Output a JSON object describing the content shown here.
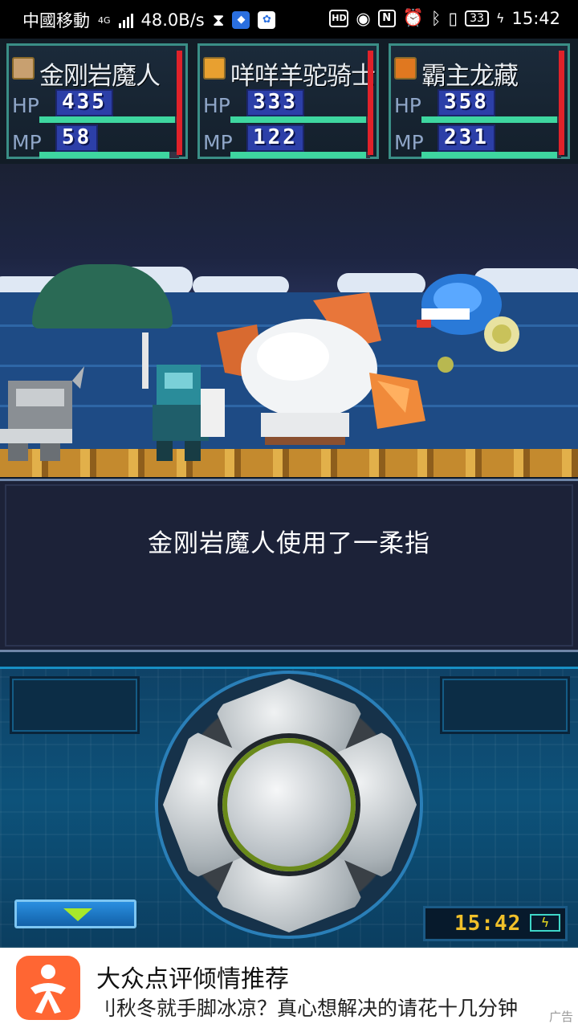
{
  "status_bar": {
    "carrier": "中國移動",
    "network": "4G",
    "speed": "48.0B/s",
    "battery": "33",
    "time": "15:42"
  },
  "party": [
    {
      "name": "金刚岩魔人",
      "hp_label": "HP",
      "hp": "435",
      "mp_label": "MP",
      "mp": "58",
      "hp_fill": 0.97,
      "mp_fill": 0.93,
      "icon_color": "#c8a070"
    },
    {
      "name": "咩咩羊驼骑士",
      "hp_label": "HP",
      "hp": "333",
      "mp_label": "MP",
      "mp": "122",
      "hp_fill": 0.97,
      "mp_fill": 0.97,
      "icon_color": "#e8a030"
    },
    {
      "name": "霸主龙藏",
      "hp_label": "HP",
      "hp": "358",
      "mp_label": "MP",
      "mp": "231",
      "hp_fill": 0.97,
      "mp_fill": 0.97,
      "icon_color": "#e07820"
    }
  ],
  "message": {
    "text": "金刚岩魔人使用了一柔指"
  },
  "controller": {
    "clock": "15:42",
    "accent": "#1790c4"
  },
  "ad": {
    "title": "大众点评倾情推荐",
    "description": "刂秋冬就手脚冰凉？真心想解决的请花十几分钟",
    "tag": "广告"
  }
}
